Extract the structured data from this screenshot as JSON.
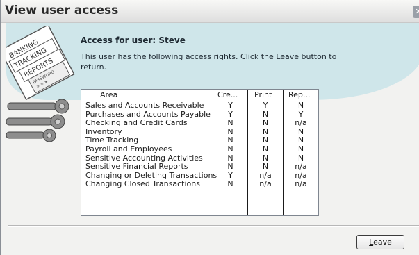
{
  "window": {
    "title": "View user access",
    "close_glyph": "✕"
  },
  "header": {
    "access_title": "Access for user: Steve",
    "description": "This user has the following access rights.  Click the Leave button to return."
  },
  "art": {
    "lines": [
      "BANKING",
      "TRACKING",
      "REPORTS",
      "PASSWORD",
      "* * *"
    ]
  },
  "table": {
    "columns": [
      "Area",
      "Cre...",
      "Print",
      "Rep..."
    ],
    "rows": [
      {
        "area": "Sales and Accounts Receivable",
        "create": "Y",
        "print": "Y",
        "report": "N"
      },
      {
        "area": "Purchases and Accounts Payable",
        "create": "Y",
        "print": "N",
        "report": "Y"
      },
      {
        "area": "Checking and Credit Cards",
        "create": "N",
        "print": "N",
        "report": "n/a"
      },
      {
        "area": "Inventory",
        "create": "N",
        "print": "N",
        "report": "N"
      },
      {
        "area": "Time Tracking",
        "create": "N",
        "print": "N",
        "report": "N"
      },
      {
        "area": "Payroll and Employees",
        "create": "N",
        "print": "N",
        "report": "N"
      },
      {
        "area": "Sensitive Accounting Activities",
        "create": "N",
        "print": "N",
        "report": "N"
      },
      {
        "area": "Sensitive Financial Reports",
        "create": "N",
        "print": "N",
        "report": "n/a"
      },
      {
        "area": "Changing or Deleting Transactions",
        "create": "Y",
        "print": "n/a",
        "report": "n/a"
      },
      {
        "area": "Changing Closed Transactions",
        "create": "N",
        "print": "n/a",
        "report": "n/a"
      }
    ]
  },
  "buttons": {
    "leave_mnemonic": "L",
    "leave_rest": "eave"
  },
  "colors": {
    "blob": "#cfe6ea",
    "window_bg": "#f2f2f0"
  },
  "icons": {
    "close": "close-icon",
    "art": "keys-password-icon"
  }
}
